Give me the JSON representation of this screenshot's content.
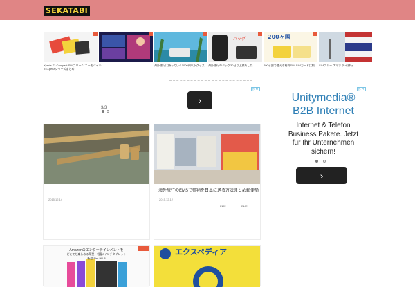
{
  "site": {
    "logo": "SEKATABI"
  },
  "strip": {
    "items": [
      {
        "caption": "Xperia Z3 Compact SIMフリー ソニーモバイル TEXperiaシリーズまとめ"
      },
      {
        "caption": ""
      },
      {
        "caption": "海外旅行に持っていく1000円以下グッズ"
      },
      {
        "caption": "海外旅行のバッグ30日以上旅をした"
      },
      {
        "caption": "200ヶ国で使える格安SIM SIMカード比較"
      },
      {
        "caption": "SIMフリー スマホ タイ旅行"
      }
    ]
  },
  "ad_left": {
    "counter": "3/3"
  },
  "ad_right": {
    "headline_line1": "Unitymedia®",
    "headline_line2": "B2B Internet",
    "body_line1": "Internet & Telefon",
    "body_line2": "Business Pakete. Jetzt",
    "body_line3": "für Ihr Unternehmen",
    "body_line4": "sichern!"
  },
  "cards": [
    {
      "date": "2015.12.14",
      "title": ""
    },
    {
      "date": "2015.12.12",
      "title": "海外旅行のEMSで荷物を日本に送る方法まとめ郵便局の窓口でやってみた",
      "tag1": "EMS",
      "tag2": "EMS"
    },
    {
      "overlay_line1": "Amazonのエンターテインメントを",
      "overlay_line2": "どこでも楽しめる薄型・軽量8インチタブレット",
      "overlay_line3": "新型 Fire HD 8"
    },
    {
      "overlay": "エクスペディア"
    }
  ],
  "colors": {
    "header": "#e08585",
    "accent": "#e85a3c",
    "ad_headline": "#2e7fb6"
  }
}
